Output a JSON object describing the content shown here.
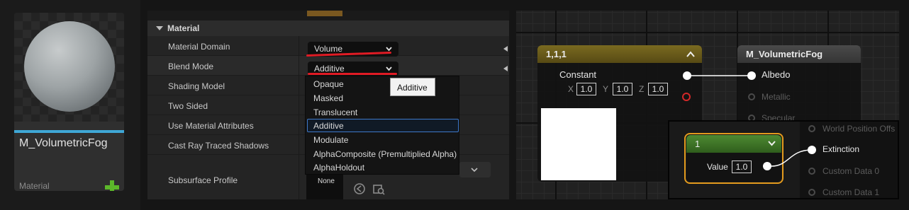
{
  "asset_card": {
    "name": "M_VolumetricFog",
    "type": "Material",
    "add_icon": "plus-icon"
  },
  "details": {
    "section_label": "Material",
    "rows": [
      {
        "label": "Material Domain"
      },
      {
        "label": "Blend Mode"
      },
      {
        "label": "Shading Model"
      },
      {
        "label": "Two Sided"
      },
      {
        "label": "Use Material Attributes"
      },
      {
        "label": "Cast Ray Traced Shadows"
      },
      {
        "label": "Subsurface Profile"
      }
    ],
    "material_domain_value": "Volume",
    "blend_mode_value": "Additive",
    "blend_mode_options": [
      "Opaque",
      "Masked",
      "Translucent",
      "Additive",
      "Modulate",
      "AlphaComposite (Premultiplied Alpha)",
      "AlphaHoldout"
    ],
    "blend_mode_highlighted": "Additive",
    "tooltip": "Additive",
    "subsurface_value": "None",
    "accent_color": "#e01b24"
  },
  "graph": {
    "constant_node": {
      "title": "1,1,1",
      "output_label": "Constant",
      "x_label": "X",
      "x_value": "1.0",
      "y_label": "Y",
      "y_value": "1.0",
      "z_label": "Z",
      "z_value": "1.0"
    },
    "material_node": {
      "title": "M_VolumetricFog",
      "pins": [
        "Albedo",
        "Metallic",
        "Specular"
      ]
    },
    "scalar_node": {
      "title": "1",
      "value_label": "Value",
      "value": "1.0"
    },
    "lower_pins": [
      "World Position Offs",
      "Extinction",
      "Custom Data 0",
      "Custom Data 1"
    ],
    "highlight_color": "#e39a1d"
  }
}
